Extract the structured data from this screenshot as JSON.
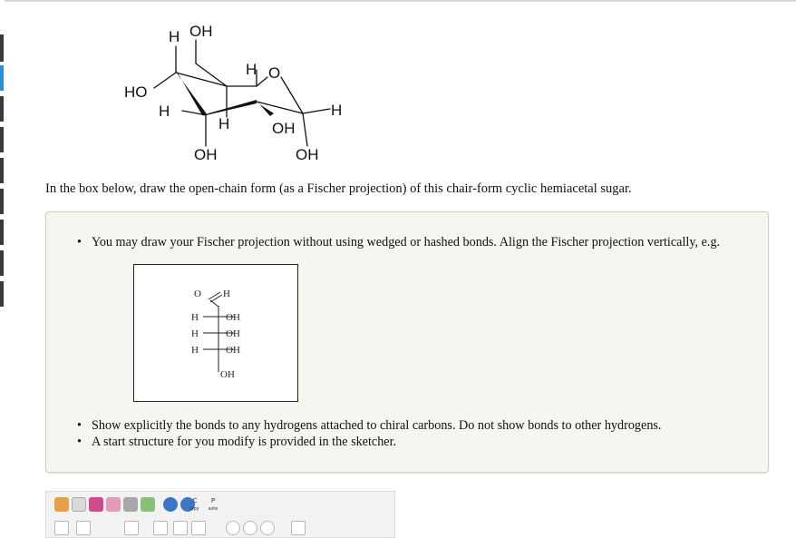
{
  "chair_labels": {
    "top_h": "H",
    "top_oh": "OH",
    "ho_left": "HO",
    "h_left": "H",
    "h_mid_top": "H",
    "ring_o": "O",
    "h_right": "H",
    "h_mid_bottom": "H",
    "oh_mid": "OH",
    "oh_bottom_left": "OH",
    "oh_bottom_right": "OH"
  },
  "question": "In the box below, draw the open-chain form (as a Fischer projection) of this chair-form cyclic hemiacetal sugar.",
  "instructions": [
    "You may draw your Fischer projection without using wedged or hashed bonds. Align the Fischer projection vertically, e.g.",
    "Show explicitly the bonds to any hydrogens attached to chiral carbons. Do not show bonds to other hydrogens.",
    "A start structure for you modify is provided in the sketcher."
  ],
  "example": {
    "top_o": "O",
    "top_h": "H",
    "rows": [
      {
        "left": "H",
        "right": "OH"
      },
      {
        "left": "H",
        "right": "OH"
      },
      {
        "left": "H",
        "right": "OH"
      }
    ],
    "bottom": "OH"
  },
  "toolbar": {
    "copy_top": "C",
    "copy_sub": "opy",
    "paste_top": "P",
    "paste_sub": "aste"
  },
  "colors": {
    "panel_bg": "#f5f6ef",
    "accent_blue": "#2c8fd6"
  }
}
